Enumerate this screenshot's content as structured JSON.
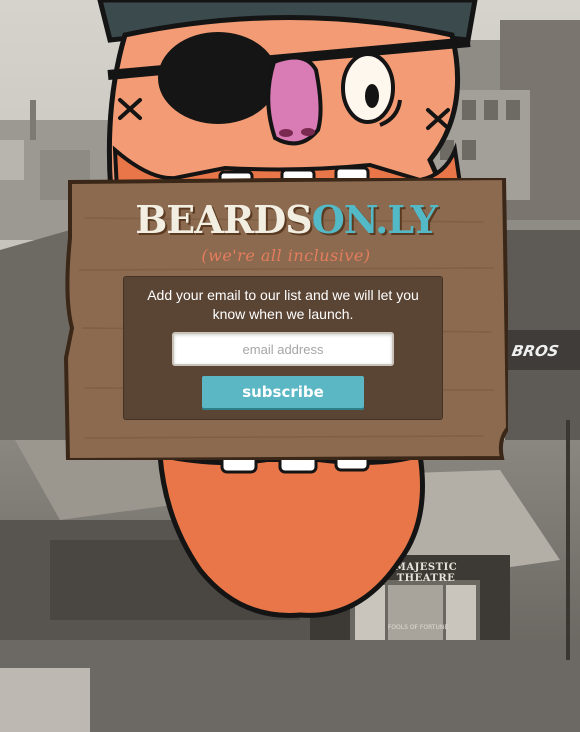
{
  "brand": {
    "name_main": "BEARDS",
    "name_accent": "ON.LY",
    "tagline": "(we're all inclusive)"
  },
  "signup": {
    "message": "Add your email to our list and we will let you know when we launch.",
    "email_placeholder": "email address",
    "email_value": "",
    "subscribe_label": "subscribe"
  },
  "background": {
    "theatre_sign": "MAJESTIC THEATRE",
    "theatre_poster": "FOOLS OF FORTUNE",
    "storefront_sign": "BROS"
  },
  "colors": {
    "accent_teal": "#53b9c6",
    "button_teal": "#5bb7c4",
    "skin": "#f39b74",
    "beard": "#e87648",
    "wood": "#8b6a4f",
    "panel": "#5a4434",
    "tagline": "#e47d5d"
  },
  "icons": [
    "pirate-face-illustration",
    "eyepatch-icon",
    "x-eye-mark-icon",
    "tooth-icon"
  ]
}
